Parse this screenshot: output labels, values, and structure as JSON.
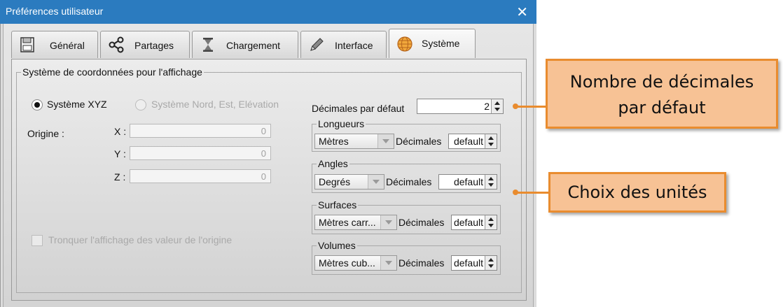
{
  "window": {
    "title": "Préférences utilisateur",
    "close_glyph": "✕"
  },
  "tabs": [
    {
      "label": "Général",
      "icon": "save-icon"
    },
    {
      "label": "Partages",
      "icon": "share-icon"
    },
    {
      "label": "Chargement",
      "icon": "hourglass-icon"
    },
    {
      "label": "Interface",
      "icon": "pencil-icon"
    },
    {
      "label": "Système",
      "icon": "globe-icon",
      "active": true
    }
  ],
  "coords": {
    "group_title": "Système de coordonnées pour l'affichage",
    "radio_xyz": "Système XYZ",
    "radio_neh": "Système Nord, Est, Elévation",
    "origin_label": "Origine :",
    "x_label": "X :",
    "x_value": "0",
    "y_label": "Y :",
    "y_value": "0",
    "z_label": "Z :",
    "z_value": "0",
    "truncate_label": "Tronquer l'affichage des valeur de l'origine"
  },
  "decimals": {
    "label": "Décimales par défaut",
    "value": "2"
  },
  "units": {
    "lengths": {
      "title": "Longueurs",
      "unit": "Mètres",
      "dec_label": "Décimales",
      "dec_value": "default"
    },
    "angles": {
      "title": "Angles",
      "unit": "Degrés",
      "dec_label": "Décimales",
      "dec_value": "default"
    },
    "surfaces": {
      "title": "Surfaces",
      "unit": "Mètres carr...",
      "dec_label": "Décimales",
      "dec_value": "default"
    },
    "volumes": {
      "title": "Volumes",
      "unit": "Mètres cub...",
      "dec_label": "Décimales",
      "dec_value": "default"
    }
  },
  "callouts": {
    "decimals_line1": "Nombre de décimales",
    "decimals_line2": "par défaut",
    "units": "Choix des unités"
  },
  "colors": {
    "titlebar": "#2b7bbf",
    "callout_fill": "#f7c295",
    "callout_border": "#e98c2f"
  }
}
